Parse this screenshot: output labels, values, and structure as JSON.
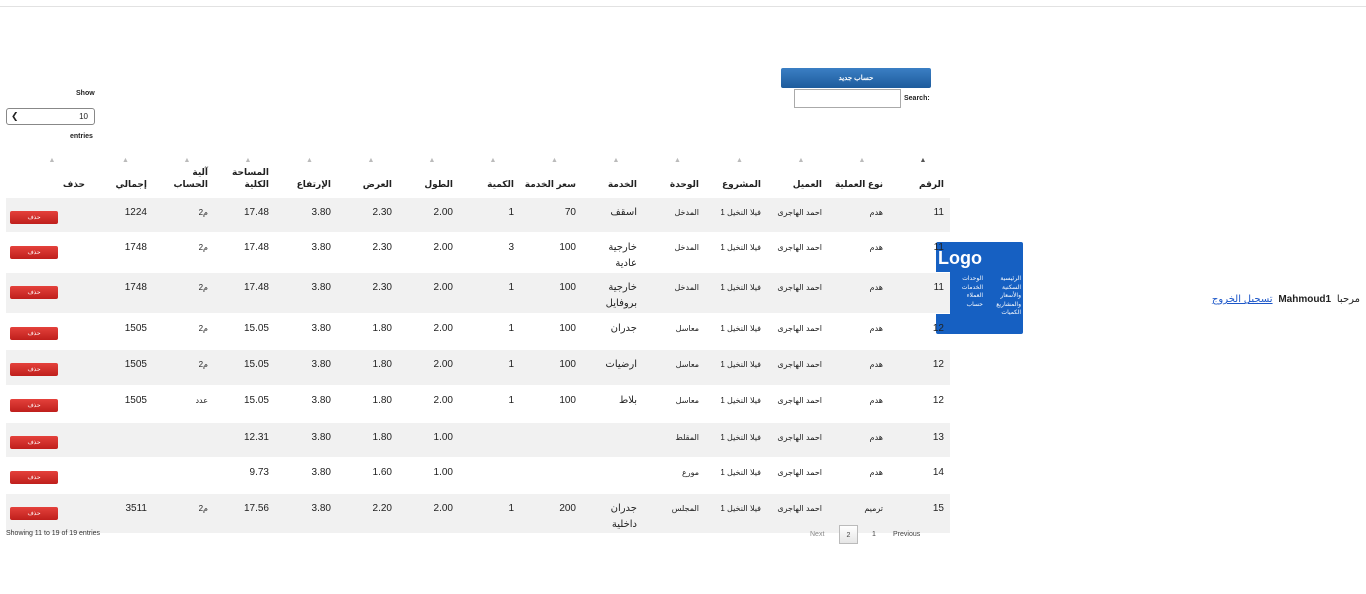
{
  "header": {
    "welcome": "مرحبا",
    "username": "Mahmoud1",
    "logout": "تسجيل الخروج"
  },
  "logo": {
    "title": "Logo",
    "nav_col1": [
      "الرئيسية",
      "السكنية",
      "والأسعار",
      "والمشاريع",
      "الكميات"
    ],
    "nav_col2": [
      "الوحدات",
      "الخدمات",
      "العملاء",
      "حساب"
    ]
  },
  "controls": {
    "new_button": "حساب جديد",
    "search_label": "Search:",
    "search_value": "",
    "search_placeholder": "",
    "show_label": "Show",
    "entries_value": "10",
    "entries_label": "entries"
  },
  "table": {
    "headers": [
      "الرقم",
      "نوع العملية",
      "العميل",
      "المشروع",
      "الوحدة",
      "الخدمة",
      "سعر الخدمة",
      "الكمية",
      "الطول",
      "العرض",
      "الإرتفاع",
      "المساحة الكلية",
      "آلية الحساب",
      "إجمالي",
      "حذف"
    ],
    "delete_label": "حذف",
    "rows": [
      [
        "11",
        "هدم",
        "احمد الهاجرى",
        "فيلا النخيل 1",
        "المدخل",
        "اسقف",
        "70",
        "1",
        "2.00",
        "2.30",
        "3.80",
        "17.48",
        "م2",
        "1224"
      ],
      [
        "11",
        "هدم",
        "احمد الهاجرى",
        "فيلا النخيل 1",
        "المدخل",
        "خارجية عادية",
        "100",
        "3",
        "2.00",
        "2.30",
        "3.80",
        "17.48",
        "م2",
        "1748"
      ],
      [
        "11",
        "هدم",
        "احمد الهاجرى",
        "فيلا النخيل 1",
        "المدخل",
        "خارجية بروفايل",
        "100",
        "1",
        "2.00",
        "2.30",
        "3.80",
        "17.48",
        "م2",
        "1748"
      ],
      [
        "12",
        "هدم",
        "احمد الهاجرى",
        "فيلا النخيل 1",
        "معاسل",
        "جدران",
        "100",
        "1",
        "2.00",
        "1.80",
        "3.80",
        "15.05",
        "م2",
        "1505"
      ],
      [
        "12",
        "هدم",
        "احمد الهاجرى",
        "فيلا النخيل 1",
        "معاسل",
        "ارضيات",
        "100",
        "1",
        "2.00",
        "1.80",
        "3.80",
        "15.05",
        "م2",
        "1505"
      ],
      [
        "12",
        "هدم",
        "احمد الهاجرى",
        "فيلا النخيل 1",
        "معاسل",
        "بلاط",
        "100",
        "1",
        "2.00",
        "1.80",
        "3.80",
        "15.05",
        "عدد",
        "1505"
      ],
      [
        "13",
        "هدم",
        "احمد الهاجرى",
        "فيلا النخيل 1",
        "المقلط",
        "",
        "",
        "",
        "1.00",
        "1.80",
        "3.80",
        "12.31",
        "",
        ""
      ],
      [
        "14",
        "هدم",
        "احمد الهاجرى",
        "فيلا النخيل 1",
        "مورع",
        "",
        "",
        "",
        "1.00",
        "1.60",
        "3.80",
        "9.73",
        "",
        ""
      ],
      [
        "15",
        "ترميم",
        "احمد الهاجرى",
        "فيلا النخيل 1",
        "المجلس",
        "جدران داخلية",
        "200",
        "1",
        "2.00",
        "2.20",
        "3.80",
        "17.56",
        "م2",
        "3511"
      ]
    ]
  },
  "footer": {
    "info": "Showing 11 to 19 of 19 entries",
    "next": "Next",
    "page_current": "2",
    "page_1": "1",
    "previous": "Previous"
  }
}
